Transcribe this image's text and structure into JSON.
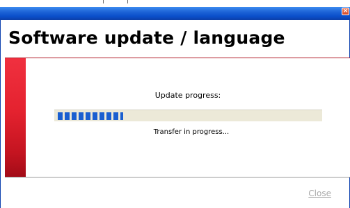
{
  "window": {
    "close_button_glyph": "×",
    "accent_color": "#e4222f",
    "titlebar_color": "#0a4fcb"
  },
  "dialog": {
    "title": "Software update / language",
    "progress_label": "Update progress:",
    "progress_fraction": 0.25,
    "progress_color": "#1a5fd0",
    "status_text": "Transfer in progress...",
    "close_link": "Close"
  }
}
